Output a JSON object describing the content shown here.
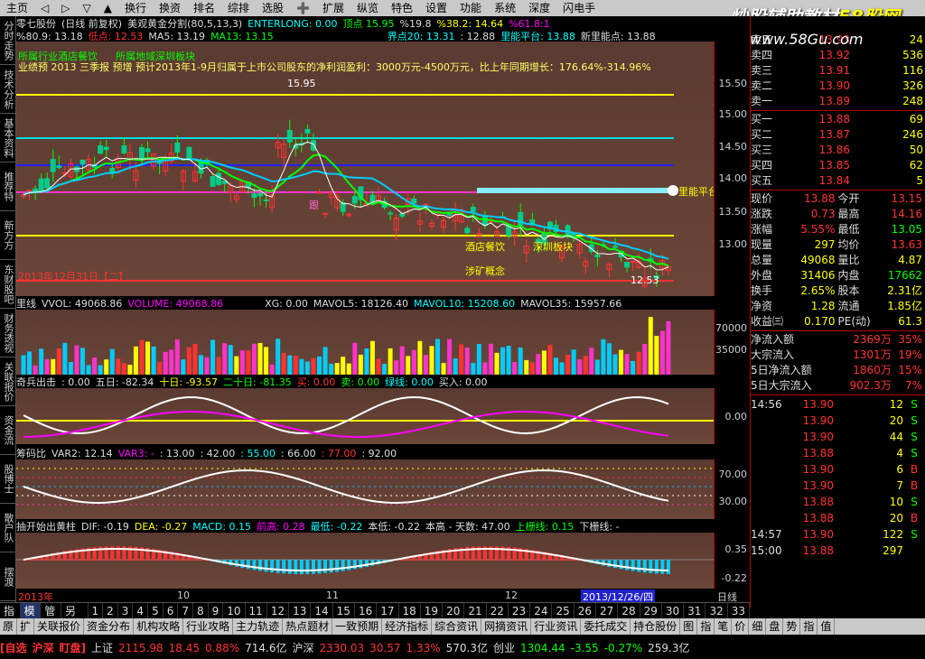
{
  "menubar": {
    "items": [
      "主页",
      "◁",
      "▷",
      "▽",
      "▲",
      "换行",
      "换资",
      "排名",
      "综排",
      "选股",
      "➕",
      "扩展",
      "纵览",
      "特色",
      "设置",
      "功能",
      "系统",
      "深度",
      "闪电手"
    ]
  },
  "watermark": {
    "line1": "炒股辅助教材",
    "line2": "58股网",
    "url": "www.58Gu.com"
  },
  "vertical_tabs": [
    "分时走势",
    "技术分析",
    "基本资料",
    "推荐特",
    "新方方",
    "东财股吧",
    "财务透视",
    "关联报价",
    "资金流",
    "股博士",
    "散户队",
    "摆渡"
  ],
  "stock": {
    "name": "零七股份",
    "mode": "(日线 前复权)",
    "indicator": "美观黄金分割(80,5,13,3)",
    "enterlong": "ENTERLONG: 0.00",
    "top": "顶点 15.95",
    "pct": "%19.8",
    "s50": "%50.0",
    "pct382": "%38.2: 14.64",
    "l61": "%61.8:1",
    "r809": "%80.9: 13.18",
    "low": "低点: 12.53",
    "ma5": "MA5: 13.19",
    "ma13": "MA13: 13.15",
    "jd": "界点20: 13.31",
    "a1288": ": 12.88",
    "ptf": "里能平台: 13.88",
    "newpt": "新里能点: 13.88"
  },
  "main_chart": {
    "news": "业绩预 2013 三季报 预增 预计2013年1-9月归属于上市公司股东的净利润盈利：3000万元-4500万元，比上年同期增长：176.64%-314.96%",
    "tags": [
      "所属行业酒店餐饮",
      "所属地域深圳板块"
    ],
    "label_hotel": "酒店餐饮",
    "label_sz": "深圳板块",
    "label_mine": "涉矿概念",
    "label_gen": "跟",
    "high_label": "15.95",
    "low_label": "12.53",
    "date_label": "2013年12月31日【二】",
    "right_marker": "里能平台",
    "yaxis": [
      "15.50",
      "15.00",
      "14.50",
      "14.00",
      "13.50",
      "13.00"
    ]
  },
  "vol_panel": {
    "hdr": [
      "里线",
      "VVOL: 49068.86",
      "VOLUME: 49068.86",
      "XG: 0.00",
      "MAVOL5: 18126.40",
      "MAVOL10: 15208.60",
      "MAVOL35: 15957.66"
    ],
    "yaxis": [
      "70000",
      "35000"
    ]
  },
  "qb_panel": {
    "hdr": [
      "奇兵出击",
      ": 0.00",
      "五日: -82.34",
      "十日: -93.57",
      "二十日: -81.35",
      "买: 0.00",
      "卖: 0.00",
      "绿线: 0.00",
      "买入: 0.00"
    ],
    "yaxis": [
      "0.00"
    ]
  },
  "cm_panel": {
    "hdr": [
      "筹码比",
      "VAR2: 12.14",
      "VAR3: -",
      ": 13.00",
      ": 42.00",
      ": 55.00",
      ": 66.00",
      ": 77.00",
      ": 92.00"
    ],
    "yaxis": [
      "70.00",
      "30.00"
    ]
  },
  "dif_panel": {
    "hdr": [
      "抽开始出黄柱",
      "DIF: -0.19",
      "DEA: -0.27",
      "MACD: 0.15",
      "前高: 0.28",
      "最低: -0.22",
      "本低: -0.22",
      "本高 - 天数: 47.00",
      "上栅线: 0.15",
      "下栅线: -"
    ],
    "yaxis": [
      "0.35",
      "-0.22"
    ]
  },
  "time_axis": {
    "labels": [
      "2013年",
      "10",
      "11",
      "12",
      "2013/12/26/四"
    ],
    "right": "日线"
  },
  "tabbar": [
    "指标",
    "模板",
    "管理",
    "另存为",
    "1",
    "2",
    "3",
    "4",
    "5",
    "6",
    "7",
    "8",
    "9",
    "10",
    "11",
    "12",
    "13",
    "14",
    "15",
    "16",
    "17",
    "18",
    "19",
    "20",
    "21",
    "22",
    "23",
    "24",
    "25",
    "26",
    "27",
    "28",
    "29",
    "30",
    "31",
    "32",
    "33"
  ],
  "quote": {
    "asks": [
      {
        "l": "卖五",
        "p": "13.93",
        "v": "24"
      },
      {
        "l": "卖四",
        "p": "13.92",
        "v": "536"
      },
      {
        "l": "卖三",
        "p": "13.91",
        "v": "116"
      },
      {
        "l": "卖二",
        "p": "13.90",
        "v": "326"
      },
      {
        "l": "卖一",
        "p": "13.89",
        "v": "248"
      }
    ],
    "bids": [
      {
        "l": "买一",
        "p": "13.88",
        "v": "69"
      },
      {
        "l": "买二",
        "p": "13.87",
        "v": "246"
      },
      {
        "l": "买三",
        "p": "13.86",
        "v": "50"
      },
      {
        "l": "买四",
        "p": "13.85",
        "v": "62"
      },
      {
        "l": "买五",
        "p": "13.84",
        "v": "5"
      }
    ],
    "stats": [
      [
        "现价",
        "13.88",
        "今开",
        "13.15"
      ],
      [
        "涨跌",
        "0.73",
        "最高",
        "14.16"
      ],
      [
        "涨幅",
        "5.55%",
        "最低",
        "13.05"
      ],
      [
        "现量",
        "297",
        "均价",
        "13.63"
      ],
      [
        "总量",
        "49068",
        "量比",
        "4.87"
      ],
      [
        "外盘",
        "31406",
        "内盘",
        "17662"
      ],
      [
        "换手",
        "2.65%",
        "股本",
        "2.31亿"
      ],
      [
        "净资",
        "1.28",
        "流通",
        "1.85亿"
      ],
      [
        "收益㈢",
        "0.170",
        "PE(动)",
        "61.3"
      ]
    ],
    "flows": [
      [
        "净流入额",
        "2369万",
        "35%"
      ],
      [
        "大宗流入",
        "1301万",
        "19%"
      ],
      [
        "5日净流入额",
        "1860万",
        "15%"
      ],
      [
        "5日大宗流入",
        "902.3万",
        "7%"
      ]
    ],
    "ticks": [
      [
        "14:56",
        "13.90",
        "12",
        "S"
      ],
      [
        "",
        "13.90",
        "20",
        "S"
      ],
      [
        "",
        "13.90",
        "44",
        "S"
      ],
      [
        "",
        "13.88",
        "4",
        "S"
      ],
      [
        "",
        "13.90",
        "6",
        "B"
      ],
      [
        "",
        "13.90",
        "7",
        "B"
      ],
      [
        "",
        "13.88",
        "10",
        "S"
      ],
      [
        "",
        "13.88",
        "20",
        "B"
      ],
      [
        "14:57",
        "13.90",
        "122",
        "S"
      ],
      [
        "15:00",
        "13.88",
        "297",
        ""
      ]
    ]
  },
  "bottom_tabs": [
    "原",
    "扩",
    "关联报价",
    "资金分布",
    "机构攻略",
    "行业攻略",
    "主力轨迹",
    "热点题材",
    "一致预期",
    "经济指标",
    "综合资讯",
    "网摘资讯",
    "行业资讯",
    "委托成交",
    "持仓股份",
    "图",
    "指",
    "笔",
    "价",
    "细",
    "盘",
    "势",
    "指",
    "值"
  ],
  "status": {
    "self": "[自选",
    "sh": "沪深",
    "sz": "盯盘]",
    "sh_idx": "上证",
    "sh_val": "2115.98",
    "sh_chg": "18.45",
    "sh_pct": "0.88%",
    "sh_amt": "714.6亿",
    "hs": "沪深",
    "hs_val": "2330.03",
    "hs_chg": "30.57",
    "hs_pct": "1.33%",
    "hs_amt": "570.3亿",
    "cy": "创业",
    "cy_val": "1304.44",
    "cy_chg": "-3.55",
    "cy_pct": "-0.27%",
    "cy_amt": "259.3亿"
  }
}
